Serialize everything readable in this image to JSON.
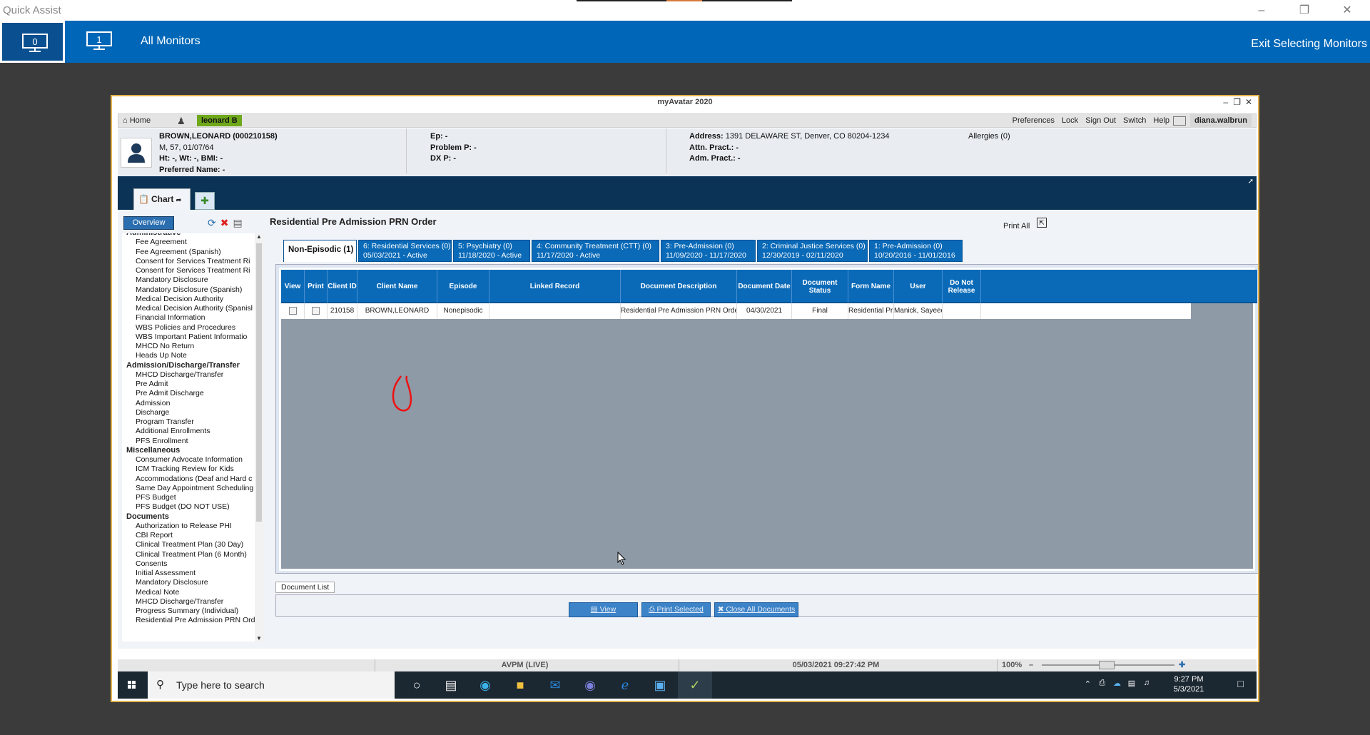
{
  "qa": {
    "title": "Quick Assist",
    "all_monitors": "All Monitors",
    "exit": "Exit Selecting Monitors",
    "monitor_0": "0",
    "monitor_1": "1"
  },
  "app": {
    "title": "myAvatar 2020"
  },
  "menu": {
    "home": "Home",
    "client_tag": "leonard B",
    "preferences": "Preferences",
    "lock": "Lock",
    "sign_out": "Sign Out",
    "switch": "Switch",
    "help": "Help",
    "user": "diana.walbrun"
  },
  "patient": {
    "name": "BROWN,LEONARD (000210158)",
    "demo": "M, 57, 01/07/64",
    "ht_wt": "Ht: -, Wt: -, BMI: -",
    "preferred": "Preferred Name: -",
    "ep": "Ep: -",
    "problem": "Problem P: -",
    "dx": "DX P: -",
    "address_label": "Address:",
    "address": "1391 DELAWARE ST, Denver, CO 80204-1234",
    "attn": "Attn. Pract.: -",
    "adm": "Adm. Pract.: -",
    "allergies": "Allergies (0)"
  },
  "chart_tab": "Chart",
  "sidebar": {
    "overview": "Overview",
    "sections": [
      {
        "header": "Administrative",
        "items": [
          "Fee Agreement",
          "Fee Agreement (Spanish)",
          "Consent for Services Treatment Ri",
          "Consent for Services Treatment Ri",
          "Mandatory Disclosure",
          "Mandatory Disclosure (Spanish)",
          "Medical Decision Authority",
          "Medical Decision Authority (Spanisl",
          "Financial Information",
          "WBS Policies and Procedures",
          "WBS Important Patient Informatio",
          "MHCD No Return",
          "Heads Up Note"
        ]
      },
      {
        "header": "Admission/Discharge/Transfer",
        "items": [
          "MHCD Discharge/Transfer",
          "Pre Admit",
          "Pre Admit Discharge",
          "Admission",
          "Discharge",
          "Program Transfer",
          "Additional Enrollments",
          "PFS Enrollment"
        ]
      },
      {
        "header": "Miscellaneous",
        "items": [
          "Consumer Advocate Information",
          "ICM Tracking Review for Kids",
          "Accommodations (Deaf and Hard c",
          "Same Day Appointment Scheduling",
          "PFS Budget",
          "PFS Budget (DO NOT USE)"
        ]
      },
      {
        "header": "Documents",
        "items": [
          "Authorization to Release PHI",
          "CBI Report",
          "Clinical Treatment Plan (30 Day)",
          "Clinical Treatment Plan (6 Month)",
          "Consents",
          "Initial Assessment",
          "Mandatory Disclosure",
          "Medical Note",
          "MHCD Discharge/Transfer",
          "Progress Summary (Individual)",
          "Residential Pre Admission PRN Ord"
        ]
      }
    ]
  },
  "doc": {
    "title": "Residential Pre Admission PRN Order",
    "print_all": "Print All",
    "doc_list": "Document List"
  },
  "tabs": [
    {
      "l1": "Non-Episodic (1)",
      "l2": ""
    },
    {
      "l1": "6: Residential Services (0)",
      "l2": "05/03/2021 - Active"
    },
    {
      "l1": "5: Psychiatry (0)",
      "l2": "11/18/2020 - Active"
    },
    {
      "l1": "4: Community Treatment (CTT) (0)",
      "l2": "11/17/2020 - Active"
    },
    {
      "l1": "3: Pre-Admission (0)",
      "l2": "11/09/2020 - 11/17/2020"
    },
    {
      "l1": "2: Criminal Justice Services (0)",
      "l2": "12/30/2019 - 02/11/2020"
    },
    {
      "l1": "1: Pre-Admission (0)",
      "l2": "10/20/2016 - 11/01/2016"
    }
  ],
  "table": {
    "headers": [
      "View",
      "Print",
      "Client ID",
      "Client Name",
      "Episode",
      "Linked Record",
      "Document Description",
      "Document Date",
      "Document Status",
      "Form Name",
      "User",
      "Do Not Release"
    ],
    "rows": [
      [
        "",
        "",
        "210158",
        "BROWN,LEONARD",
        "Nonepisodic",
        "",
        "Residential Pre Admission PRN Order-R...",
        "04/30/2021",
        "Final",
        "Residential Pr...",
        "Manick, Sayeed",
        ""
      ]
    ]
  },
  "buttons": {
    "view": "View",
    "print_selected": "Print Selected",
    "close_all": "Close All Documents"
  },
  "status": {
    "env": "AVPM (LIVE)",
    "datetime": "05/03/2021 09:27:42 PM",
    "zoom": "100%"
  },
  "taskbar": {
    "search": "Type here to search",
    "time": "9:27 PM",
    "date": "5/3/2021"
  }
}
